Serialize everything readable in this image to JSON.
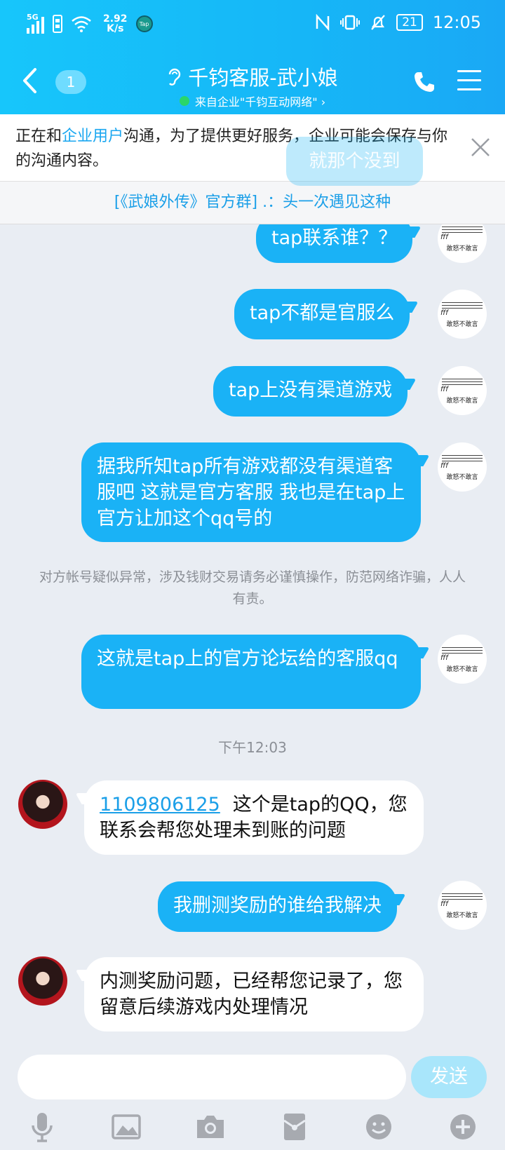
{
  "status_bar": {
    "network": "5G",
    "speed_value": "2.92",
    "speed_unit": "K/s",
    "app_badge": "Tap",
    "battery": "21",
    "time": "12:05"
  },
  "header": {
    "unread_count": "1",
    "title": "千钧客服-武小娘",
    "subtitle": "来自企业\"千钧互动网络\" ›"
  },
  "notice": {
    "text_before": "正在和",
    "highlight": "企业用户",
    "text_after": "沟通，为了提供更好服务，企业可能会保存与你的沟通内容。",
    "ghost_bubble": "就那个没到"
  },
  "pinned_message": "[《武娘外传》官方群] .：头一次遇见这种",
  "avatar_label": "敢怒不敢言",
  "messages": {
    "m1": "tap联系谁？？",
    "m2": "tap不都是官服么",
    "m3": "tap上没有渠道游戏",
    "m4": "据我所知tap所有游戏都没有渠道客服吧 这就是官方客服 我也是在tap上官方让加这个qq号的",
    "system_warning": "对方帐号疑似异常，涉及钱财交易请务必谨慎操作，防范网络诈骗，人人有责。",
    "m5": "这就是tap上的官方论坛给的客服qq",
    "timestamp": "下午12:03",
    "r1_link": "1109806125",
    "r1_text": "这个是tap的QQ，您联系会帮您处理未到账的问题",
    "m6": "我删测奖励的谁给我解决",
    "r2_text": "内测奖励问题，已经帮您记录了，您留意后续游戏内处理情况"
  },
  "input": {
    "value": "",
    "send_label": "发送"
  },
  "toolbar": [
    "voice-icon",
    "image-icon",
    "camera-icon",
    "red-packet-icon",
    "emoji-icon",
    "plus-icon"
  ]
}
